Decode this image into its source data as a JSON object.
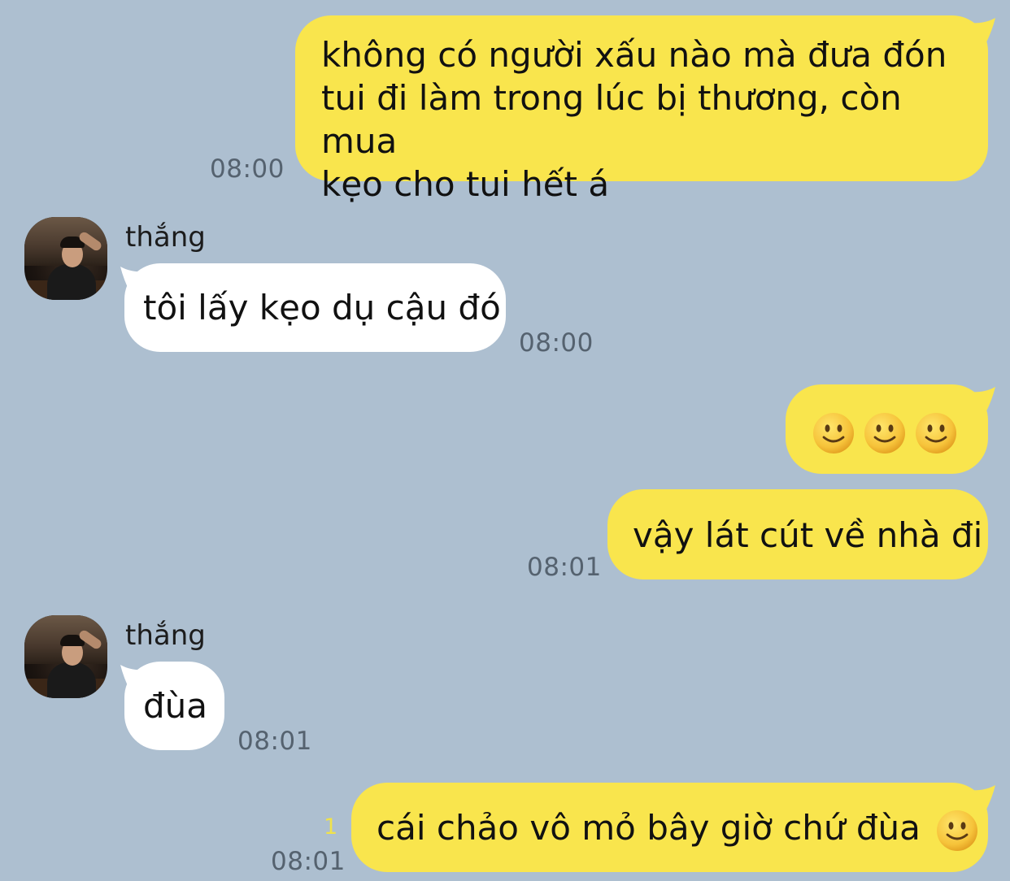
{
  "chat": {
    "contact_name": "thắng",
    "messages": [
      {
        "from": "me",
        "lines": [
          "không có người xấu nào mà đưa đón",
          "tui đi làm trong lúc bị thương, còn mua",
          "kẹo cho tui hết á"
        ],
        "time": "08:00"
      },
      {
        "from": "them",
        "sender": "thắng",
        "text": "tôi lấy kẹo dụ cậu đó",
        "time": "08:00"
      },
      {
        "from": "me",
        "emoji_count": 3,
        "emoji": "slightly-smiling-face"
      },
      {
        "from": "me",
        "text": "vậy lát cút về nhà đi",
        "time": "08:01"
      },
      {
        "from": "them",
        "sender": "thắng",
        "text": "đùa",
        "time": "08:01"
      },
      {
        "from": "me",
        "text": "cái chảo vô mỏ bây giờ chứ đùa",
        "emoji": "slightly-smiling-face",
        "read_count": "1",
        "time": "08:01"
      }
    ]
  },
  "colors": {
    "background": "#adbfd0",
    "my_bubble": "#f9e54d",
    "their_bubble": "#ffffff",
    "timestamp": "#55626f",
    "read_indicator": "#f0e24a"
  }
}
